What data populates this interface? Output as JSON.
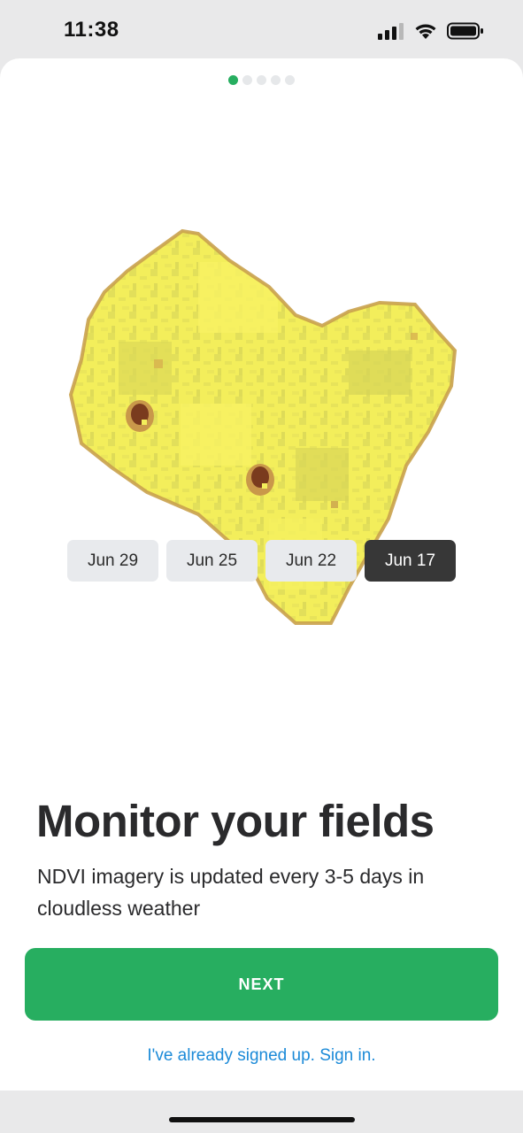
{
  "status_bar": {
    "time": "11:38",
    "icons": [
      "signal-icon",
      "wifi-icon",
      "battery-icon"
    ]
  },
  "pager": {
    "total_pages": 5,
    "current_page": 1,
    "active_color": "#27ae60",
    "inactive_color": "#e6e8ea"
  },
  "field_map": {
    "image": "ndvi-field-heart-shape",
    "colors": [
      "#f2ee5c",
      "#ddd95a",
      "#c99a45",
      "#7a3b1e"
    ]
  },
  "dates": {
    "items": [
      {
        "label": "Jun 29",
        "selected": false
      },
      {
        "label": "Jun 25",
        "selected": false
      },
      {
        "label": "Jun 22",
        "selected": false
      },
      {
        "label": "Jun 17",
        "selected": true
      }
    ]
  },
  "content": {
    "title": "Monitor your fields",
    "subtitle": "NDVI imagery is updated every 3-5 days in cloudless weather"
  },
  "actions": {
    "next_label": "NEXT",
    "next_color": "#27ae60",
    "signin_label": "I've already signed up. Sign in.",
    "signin_color": "#1b8ad8"
  }
}
